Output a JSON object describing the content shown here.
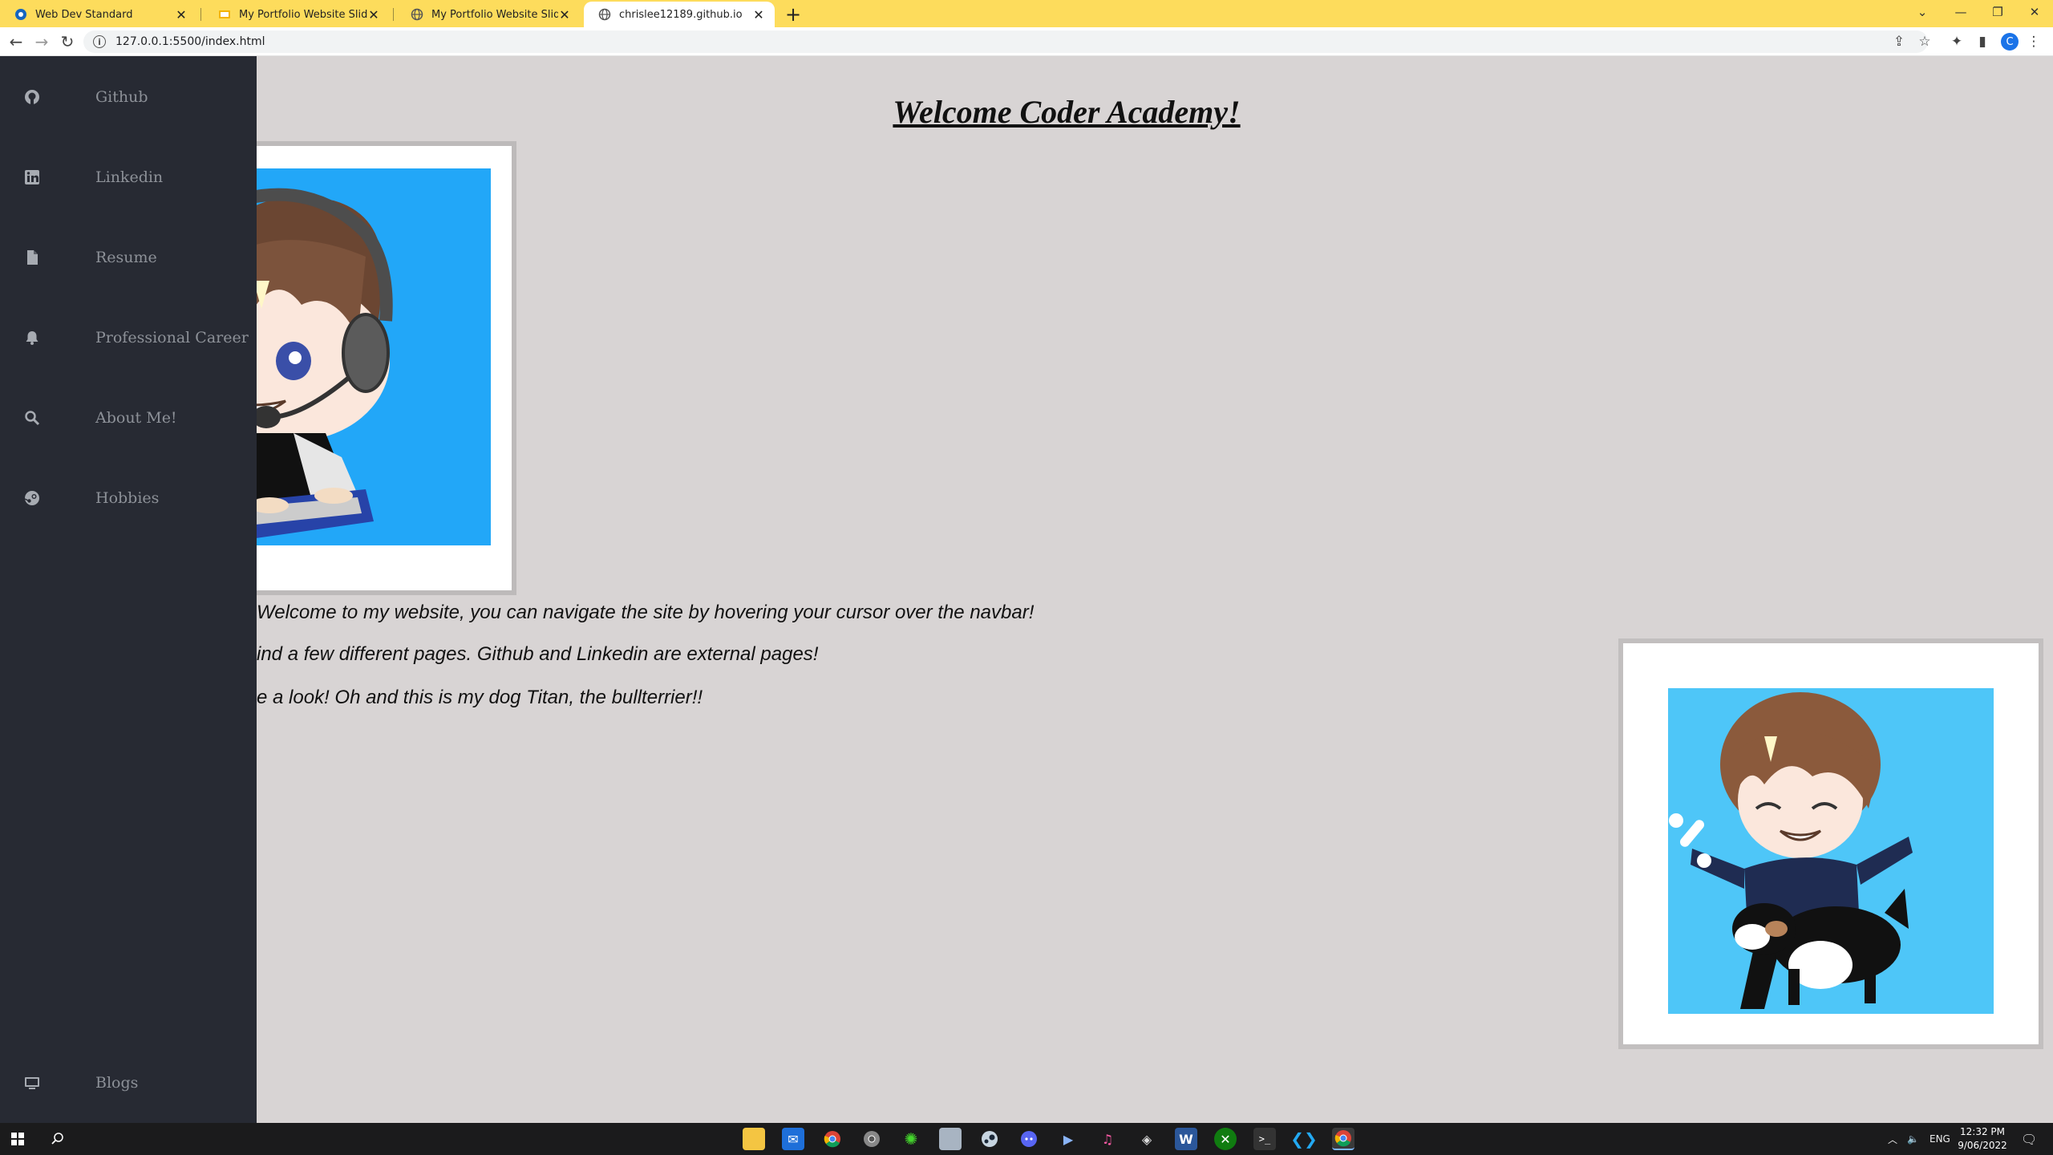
{
  "browser": {
    "tabs": [
      {
        "title": "Web Dev Standard",
        "active": false,
        "favicon": "gem-icon"
      },
      {
        "title": "My Portfolio Website Slidedeck -",
        "active": false,
        "favicon": "slides-icon"
      },
      {
        "title": "My Portfolio Website Slidedeck",
        "active": false,
        "favicon": "globe-icon"
      },
      {
        "title": "chrislee12189.github.io",
        "active": true,
        "favicon": "globe-icon"
      }
    ],
    "url": "127.0.0.1:5500/index.html",
    "profile_initial": "C",
    "colors": {
      "tabstrip": "#fddc5c",
      "active_tab": "#ffffff"
    }
  },
  "sidebar": {
    "items": [
      {
        "label": "Github",
        "icon": "github-icon"
      },
      {
        "label": "Linkedin",
        "icon": "linkedin-icon"
      },
      {
        "label": "Resume",
        "icon": "file-icon"
      },
      {
        "label": "Professional Career",
        "icon": "bell-icon"
      },
      {
        "label": "About Me!",
        "icon": "search-icon"
      },
      {
        "label": "Hobbies",
        "icon": "steam-icon"
      }
    ],
    "bottom_item": {
      "label": "Blogs",
      "icon": "monitor-icon"
    },
    "colors": {
      "background": "#272a33",
      "label": "#8d9198"
    }
  },
  "main": {
    "heading": "Welcome Coder Academy!",
    "paragraphs": [
      "Welcome to my website, you can navigate the site by hovering your cursor over the navbar!",
      "ind a few different pages. Github and Linkedin are external pages!",
      "e a look! Oh and this is my dog Titan, the bullterrier!!"
    ],
    "images": [
      {
        "subject": "chibi-gamer-with-headset"
      },
      {
        "subject": "chibi-with-bullterrier-dog"
      }
    ],
    "colors": {
      "background": "#d8d4d4"
    }
  },
  "taskbar": {
    "apps": [
      "file-explorer-icon",
      "mail-icon",
      "chrome-icon",
      "chrome-dev-icon",
      "razer-icon",
      "store-icon",
      "steam-icon",
      "discord-icon",
      "media-icon",
      "itunes-icon",
      "stack-icon",
      "word-icon",
      "xbox-icon",
      "terminal-icon",
      "vscode-icon",
      "chrome-active-icon"
    ],
    "language": "ENG",
    "time": "12:32 PM",
    "date": "9/06/2022"
  }
}
